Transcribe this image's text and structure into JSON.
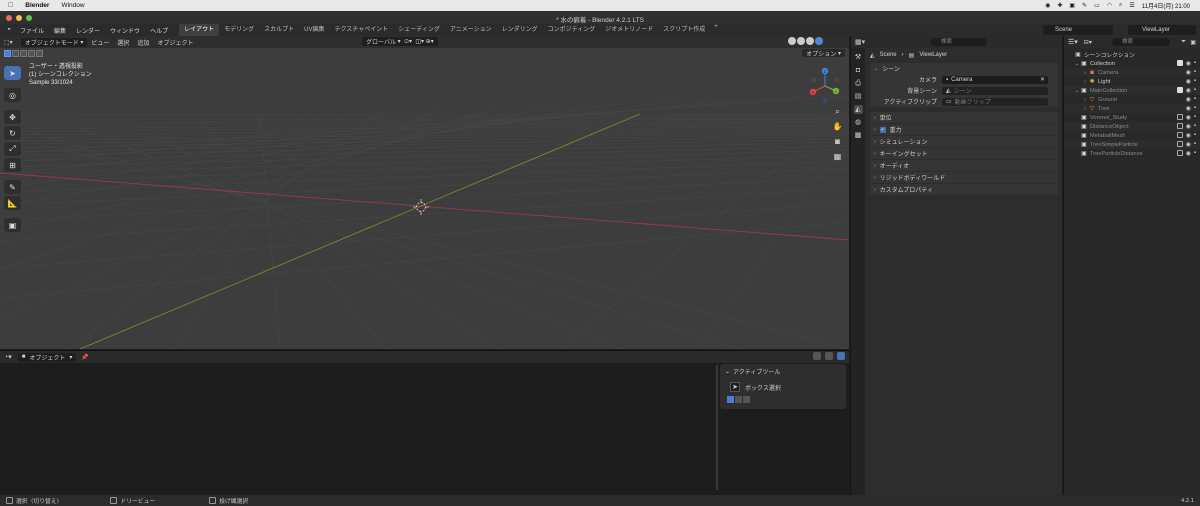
{
  "mac_menubar": {
    "app_name": "Blender",
    "menus": [
      "Window"
    ],
    "clock": "11月4日(月) 21:00"
  },
  "window": {
    "title": "* 水の癖着 - Blender 4.2.1 LTS"
  },
  "topbar": {
    "menus": [
      "ファイル",
      "編集",
      "レンダー",
      "ウィンドウ",
      "ヘルプ"
    ],
    "workspaces": [
      "レイアウト",
      "モデリング",
      "スカルプト",
      "UV編集",
      "テクスチャペイント",
      "シェーディング",
      "アニメーション",
      "レンダリング",
      "コンポジティング",
      "ジオメトリノード",
      "スクリプト作成"
    ],
    "active_workspace": "レイアウト",
    "add_tab": "+",
    "scene": "Scene",
    "view_layer": "ViewLayer"
  },
  "viewport": {
    "mode": "オブジェクトモード",
    "menus": [
      "ビュー",
      "選択",
      "追加",
      "オブジェクト"
    ],
    "transform_orientation": "グローバル",
    "options_label": "オプション",
    "info_line1": "ユーザー・透視投影",
    "info_line2": "(1) シーンコレクション",
    "info_line3": "Sample 33/1024",
    "gizmo": {
      "x": "X",
      "y": "Y",
      "z": "Z"
    }
  },
  "lower_editor": {
    "object_label": "オブジェクト",
    "active_tool_header": "アクティブツール",
    "active_tool_name": "ボックス選択"
  },
  "properties": {
    "search_placeholder": "検索",
    "breadcrumb_scene": "Scene",
    "breadcrumb_viewlayer": "ViewLayer",
    "scene_panel": {
      "title": "シーン",
      "camera_label": "カメラ",
      "camera_value": "Camera",
      "background_label": "背景シーン",
      "background_placeholder": "シーン",
      "clip_label": "アクティブクリップ",
      "clip_placeholder": "動画クリップ"
    },
    "panels": [
      "単位",
      "重力",
      "シミュレーション",
      "キーイングセット",
      "オーディオ",
      "リジッドボディワールド",
      "カスタムプロパティ"
    ]
  },
  "outliner": {
    "search_placeholder": "検索",
    "root": "シーンコレクション",
    "rows": [
      {
        "name": "Collection",
        "level": 1,
        "icon": "collection-icon",
        "dim": false
      },
      {
        "name": "Camera",
        "level": 2,
        "icon": "camera-icon",
        "dim": true
      },
      {
        "name": "Light",
        "level": 2,
        "icon": "light-icon",
        "dim": false
      },
      {
        "name": "MainCollection",
        "level": 1,
        "icon": "collection-icon",
        "dim": true
      },
      {
        "name": "Ground",
        "level": 2,
        "icon": "mesh-icon",
        "dim": true
      },
      {
        "name": "Tree",
        "level": 2,
        "icon": "mesh-icon",
        "dim": true
      },
      {
        "name": "Voronoi_Study",
        "level": 1,
        "icon": "collection-icon",
        "dim": true
      },
      {
        "name": "DistanceObject",
        "level": 1,
        "icon": "collection-icon",
        "dim": true
      },
      {
        "name": "MetaballMesh",
        "level": 1,
        "icon": "collection-icon",
        "dim": true
      },
      {
        "name": "TreeSimpleParticle",
        "level": 1,
        "icon": "collection-icon",
        "dim": true
      },
      {
        "name": "TreeParticleDistance",
        "level": 1,
        "icon": "collection-icon",
        "dim": true
      }
    ]
  },
  "statusbar": {
    "item1": "選択（切り替え）",
    "item2": "ドリービュー",
    "item3": "投げ縄選択",
    "version": "4.2.1"
  },
  "colors": {
    "accent": "#4772b3",
    "x_axis": "#9a3a46",
    "y_axis": "#6f8f2f",
    "gizmo_x": "#e0434e",
    "gizmo_y": "#7fb23b",
    "gizmo_z": "#3f86d8"
  }
}
